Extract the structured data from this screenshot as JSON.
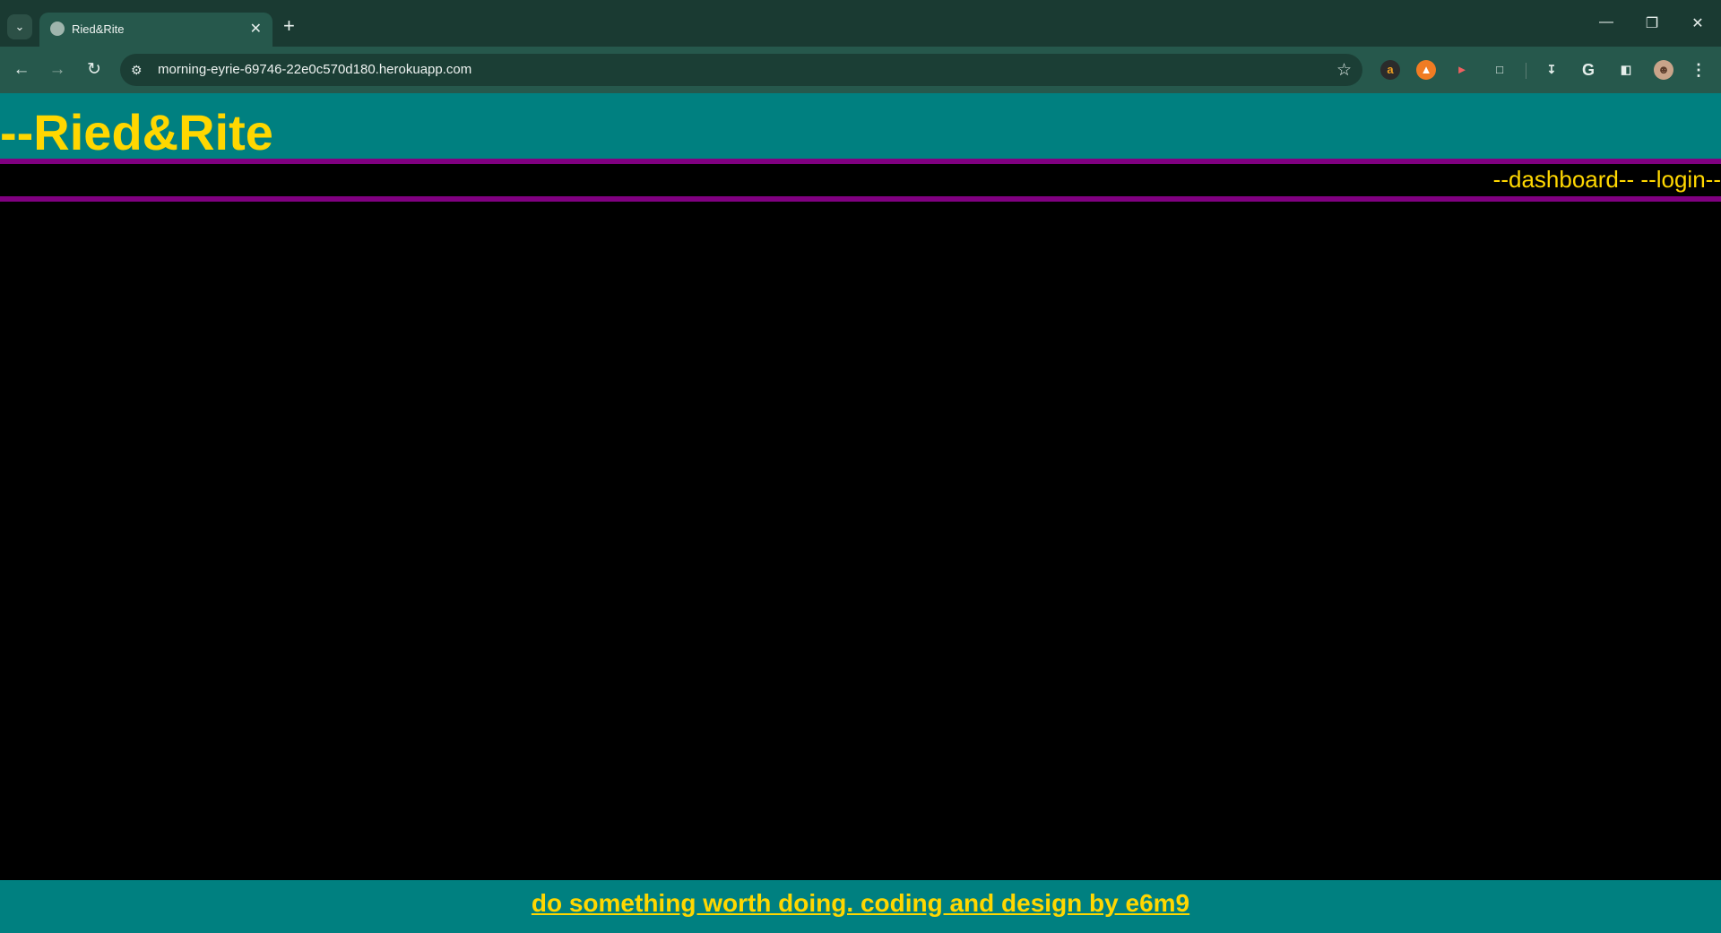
{
  "browser": {
    "tab_title": "Ried&Rite",
    "url": "morning-eyrie-69746-22e0c570d180.herokuapp.com"
  },
  "site": {
    "brand": "--Ried&Rite",
    "nav": {
      "dashboard": "--dashboard--",
      "login": "--login--"
    },
    "footer_text": "do something worth doing. coding and design by e6m9"
  },
  "colors": {
    "header_bg": "#008080",
    "brand_text": "#ffd700",
    "rule": "#800080",
    "page_bg": "#000000"
  }
}
